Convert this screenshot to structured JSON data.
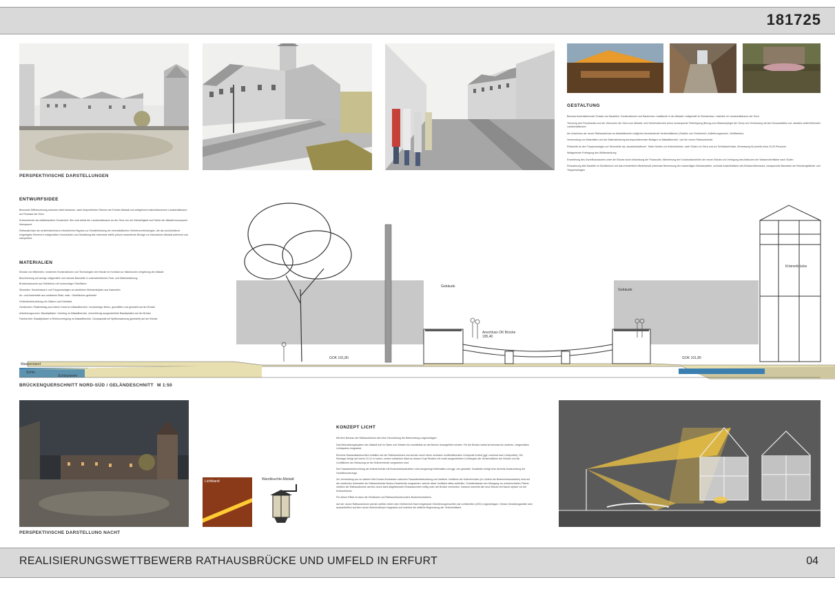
{
  "header": {
    "project_number": "181725"
  },
  "footer": {
    "title": "REALISIERUNGSWETTBEWERB RATHAUSBRÜCKE UND UMFELD IN ERFURT",
    "page": "04"
  },
  "captions": {
    "perspectives": "PERSPEKTIVISCHE DARSTELLUNGEN",
    "section": "BRÜCKENQUERSCHNITT NORD-SÜD / GELÄNDESCHNITT",
    "scale": "M 1:50",
    "night": "PERSPEKTIVISCHE DARSTELLUNG  NACHT"
  },
  "gestaltung": {
    "heading": "GESTALTUNG",
    "paragraphs": [
      "Bewusst kontrastierender Einsatz von Bauteilen, Konstruktionen und Bauformen: traditionell in der Altstadt / zeitgemäß im Brückenbau / natürlich im Landschaftsraum der Gera",
      "Trennung des Flussbaufes und der Uferzonen der Gera vom Altstadt- und Verkehrsbereich durch konsequente Tieferlegung (Bezug zum Wasserspiegel der Gera) und Verbindung mit dem flussaufwärts und -abwärts weiterführenden Landschaftsraum",
      "Am Anschluss der neuen Rathausbrücke an Altstadtbereich möglichst durchlaufende Verkehrsflächen (Straßen von Gehbereich, Anlieferungszonen, Schiffahrten)",
      "Verwendung von Materialien und der Materialwirkung korrespondierenden Belägen im Altstadtbereich / auf der neuen Rathausbrücke",
      "Rückseite an den Treppenanlagen zur Stromseite als „Aussichtsbalkone“. Nach Norden zur Krämerbrücke, nach Süden zur Gera und zur Schlösserbrücke, Bemessung für jeweils etwa 15-20 Personen",
      "Weitgehende Freilegung des Wildbedeckung",
      "Erweiterung des Durchflussraumes unter der Brücke durch Absenkung der Flusssohle, Minimierung der Konstruktionshöhe der neuen Brücke und Verlegung des Absturzes der Wasseroberfläche nach Süden",
      "Reduzierung aller Bauteile im Sichtbereich auf das erforderliche Mindestmaß (minimale Bemessung der notwendigen Brückenpfeiler, schmale Ansichtsfläche des Brückenüberbaues, transparente Bauweise der Brückengeländer und Treppenanlagen"
    ]
  },
  "entwurfsidee": {
    "heading": "ENTWURFSIDEE",
    "paragraphs": [
      "Bewusste Differenzierung zwischen dicht bebauten, stark frequentierten Flächen der Erfurter Altstadt und weitgehend naturbelassenem Landschaftsraum am Flusslauf der Gera.",
      "Krämerbrücke als städtebauliche Sonderheit. Hier wird selbst der Landschaftsraum an der Gera von der Kleinteiligkeit und Dichte der Altstadt konsequent überspannt.",
      "Rathausbrücke als verkehrstechnisch erforderlicher Bypass zur Gewährleistung der innerstädtischen Verkehrsverbindungen, die als zurückhaltend eingefügtes Element in zeitgemäßer Konstruktion und Gestaltung klar erkennbar bleibt, jedoch wesentliche Bezüge zur historischen Altstadt aufnimmt und interpretiert."
    ]
  },
  "materialien": {
    "heading": "MATERIALIEN",
    "paragraphs": [
      "Einsatz von effizienten, modernen Konstruktionen und Technologien der Brücke im Kontrast zur historischen Umgebung der Altstadt",
      "Beschichtung auf wenige zeitgemäße und robuste Baustoffe in unterschiedlichen Farb- und Materialwirkung:",
      "Brückenbauwerk aus Sichtbeton mit hochwertiger Oberfläche",
      "Sitzstufen, Sockelmauern und Treppenanlagen an westlichen Brückenköpfen aus Naturstein",
      "An- und Ankerstelle aus rostfreiem Stahl, matt - Oberflächen gebürstet",
      "Geländerbeleuchtung mit Gläsern aus Edelstahl",
      "Gehbereich: Plattenbelag aus hellem Granit im Altstadtbereich, hochwertiger Beton, geschliffen und gestrahlt auf der Brücke",
      "Anlieferungszonen: Basaltpflaster / kleinfug im Altstadtbereich, rinnenförmig ausgearbeitete Basaltplatten auf der Brücke",
      "Fahrbereich: Basaltpflaster in Reihenverlegung im Altstadtbereich, Gussasphalt mit Splitteinwalzung (gestrahlt) auf der Brücke"
    ]
  },
  "licht": {
    "heading": "KONZEPT LICHT",
    "paragraphs": [
      "Mit dem Neubau der Rathausbrücke wird eine Neuordnung der Beleuchtung vorgeschlagen:",
      "Das Beleuchtungssystem der Altstadt soll im Osten und Westen bis unmittelbar an die Brücke herangeführt werden. Für die Brücke selbst ist bewusst ein anderes, zeitgemäßes Lichtsystem eingesetzt.",
      "Einzelne Mastaufsatzleuchten entfallen auf der Rathausbrücke und werden durch einen zentralen multifunktionalen Lichtpunkt ersetzt (ggf. maximal zwei Lichtpunkte). Die Montage erfolgt auf einem 10-12 m hohen, extrem schlanken Mast an dessen Kopf Strahler mit exakt ausgerichteten Lichtkegeln die Verkehrsfläche der Brücke und die Lichtflächen der Bebauung an der Krämerbrücke vorgesehen sind.",
      "Die Fassadenbeleuchtung der Krämerbrücke mit Bodeneinbaustrahlern wird dongeneigt beibehalten und ggf. neu gestaltet. Zusätzlich erfolgt eine dezente Ausleuchtung der Gewölbeunterzüge.",
      "Zur Vermeidung von zu starken Hell-Dunkel-Kontrasten zwischen Fassadenbeleuchtung und östlicher Vorfläche der Krämerbrücke (im Umfeld der Bodeneinbaustrahler) sind auf der nördlichen Unterseite der Rathausbrücke Bodus-Gewerlichte vorgesehen, welche diese Vorfläche diffus aufhellen. Schattenkanten am Übergang zur unbeleuchteten Fläche nördlich der Rathausbrücke werden durch stark abgeblendete Einbauleuchten mittig unter der Brücke vermieden. Dadurch schwebt die neue Brücke bei Nacht optisch vor der Krämerbrücke.",
      "Für dieser Effekt ist dann die Sichtkante und Rathausbrückenuntere Bodeneinstrahlern.",
      "Auf der neuen Rathausbrücke werden seitlich neben dem Gehbereich flach eingebaute Orientierungsleuchten als Lichtstreifen (LED) vorgeschlagen. Dieses Gestaltungsmittel wird ausschließlich auf dem neuen Brückenkörper eingesetzt und markiert die seitliche Begrenzung der Verkehrsfläche."
    ]
  },
  "section_labels": {
    "gebaeude_left": "Gebäude",
    "gebaeude_right": "Gebäude",
    "kraemerbruecke": "Krämerbrücke",
    "wasserstand": "Wasserstand",
    "sohle": "Sohle",
    "schlosswehr": "Schlosswehr",
    "anschluss": "Anschluss OK Brücke",
    "anschluss_value": "195,40",
    "gok_left": "GOK 191,80",
    "gok_right": "GOK 191,80"
  },
  "detail_labels": {
    "lichtband": "Lichtband",
    "wandleuchte": "Wandleuchte Altstadt"
  },
  "colors": {
    "bar": "#d9d9d9",
    "building_grey": "#c8c8c8",
    "water": "#3b7fb0",
    "ground": "#e8dfb0",
    "night_bg": "#5a5a5a",
    "light": "#f5c842"
  }
}
